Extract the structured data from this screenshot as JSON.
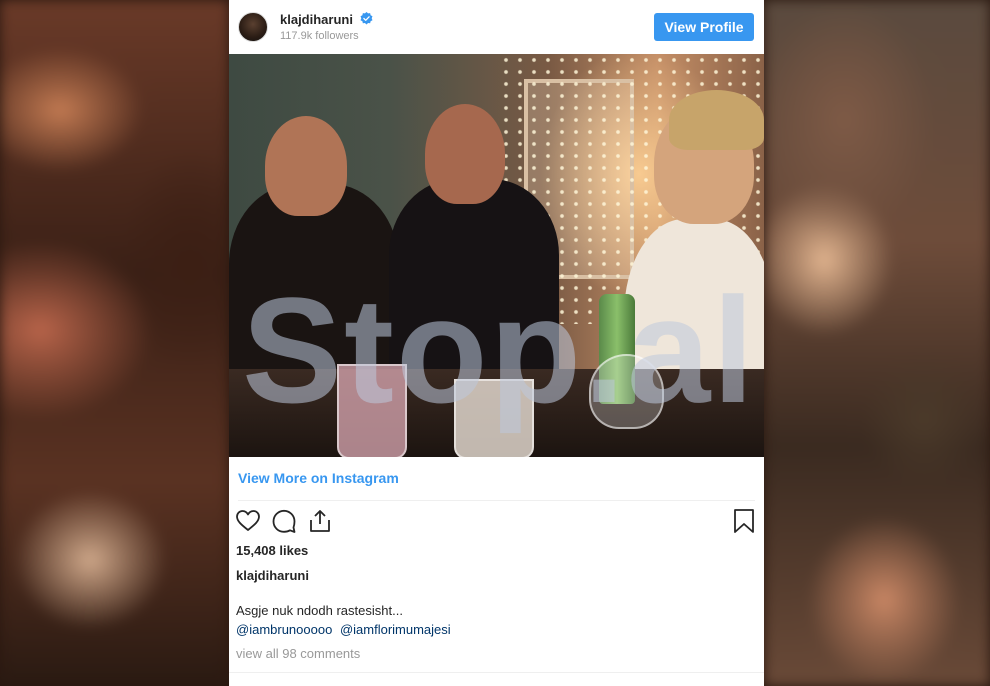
{
  "post": {
    "username": "klajdiharuni",
    "followers": "117.9k followers",
    "view_profile_label": "View Profile",
    "watermark": "Stop.al",
    "view_more_label": "View More on Instagram",
    "likes": "15,408 likes",
    "caption_user": "klajdiharuni",
    "caption": "Asgje nuk ndodh rastesisht...",
    "mentions": [
      "@iambrunooooo",
      "@iamflorimumajesi"
    ],
    "comments_link": "view all 98 comments"
  },
  "colors": {
    "accent": "#3897f0",
    "verified": "#3897f0",
    "text": "#262626",
    "muted": "#999999",
    "mention": "#003569"
  },
  "icons": [
    "verified-badge-icon",
    "heart-icon",
    "comment-icon",
    "share-icon",
    "bookmark-icon"
  ]
}
